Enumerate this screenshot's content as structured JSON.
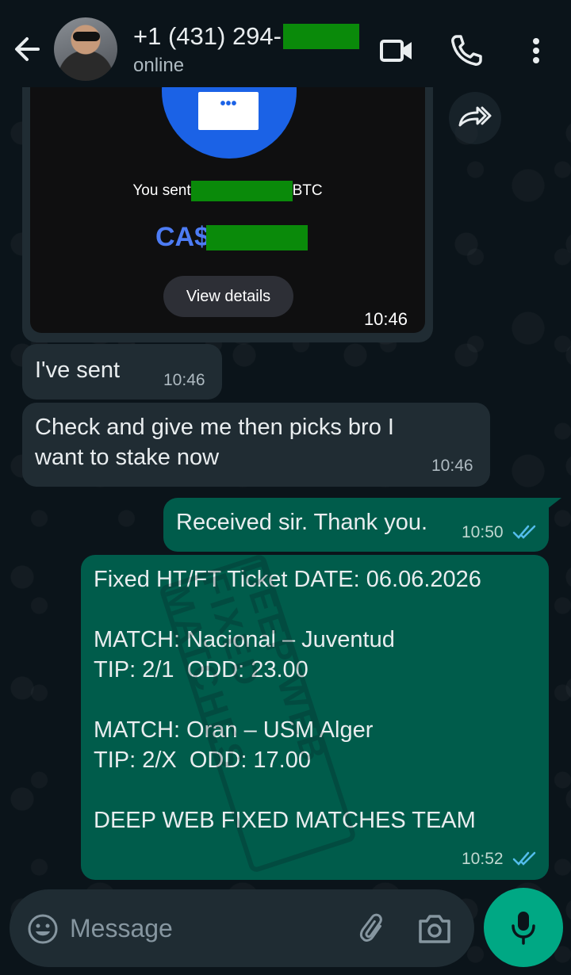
{
  "header": {
    "contact_name": "+1 (431) 294-",
    "status": "online"
  },
  "media_message": {
    "card_dots": "•••",
    "sent_text_prefix": "You sent",
    "sent_text_suffix": "BTC",
    "amount_prefix": "CA$",
    "view_details_label": "View details",
    "time": "10:46"
  },
  "messages": [
    {
      "direction": "incoming",
      "text": "I've sent",
      "time": "10:46"
    },
    {
      "direction": "incoming",
      "text": "Check and give me then picks bro I\nwant to stake now",
      "time": "10:46"
    },
    {
      "direction": "outgoing",
      "text": "Received sir. Thank you.",
      "time": "10:50",
      "read": true
    },
    {
      "direction": "outgoing",
      "text": "Fixed HT/FT Ticket DATE: 06.06.2026\n\nMATCH: Nacional – Juventud\nTIP: 2/1  ODD: 23.00\n\nMATCH: Oran – USM Alger\nTIP: 2/X  ODD: 17.00\n\nDEEP WEB FIXED MATCHES TEAM",
      "time": "10:52",
      "read": true
    }
  ],
  "watermark": {
    "text": "DEEP WEB FIXED MATCHES"
  },
  "composer": {
    "placeholder": "Message"
  },
  "colors": {
    "background": "#0b141a",
    "incoming_bubble": "#202c33",
    "outgoing_bubble": "#005c4b",
    "accent": "#00a884",
    "read_tick": "#53bdeb",
    "redaction": "#0a8a0a"
  },
  "icons": {
    "back": "arrow-left-icon",
    "video": "video-camera-icon",
    "call": "phone-icon",
    "menu": "more-vertical-icon",
    "forward": "forward-icon",
    "emoji": "emoji-icon",
    "attach": "paperclip-icon",
    "camera": "camera-icon",
    "mic": "microphone-icon"
  }
}
